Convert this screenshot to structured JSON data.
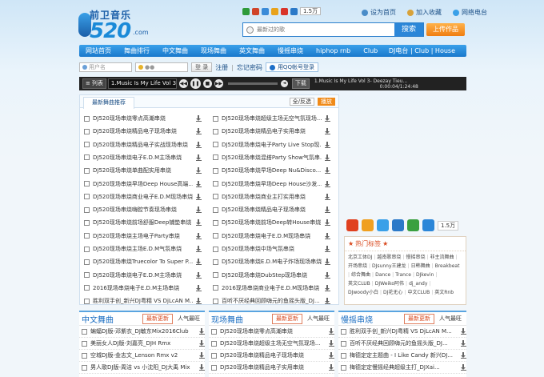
{
  "header": {
    "logo_cn": "前卫音乐",
    "logo_num": "520",
    "logo_com": ".com",
    "share_count": "1.5万",
    "links": [
      "设为首页",
      "加入收藏",
      "网络电台"
    ]
  },
  "search": {
    "placeholder": "最新过的歌",
    "button": "搜索"
  },
  "upload_label": "上传作品",
  "nav": {
    "items": [
      "网站首页",
      "舞曲排行",
      "中文舞曲",
      "现场舞曲",
      "英文舞曲",
      "慢摇串烧",
      "hiphop rnb",
      "Club"
    ],
    "right": "DJ电台 | Club | House"
  },
  "login": {
    "user_placeholder": "用户名",
    "pass_placeholder": "●●",
    "login_btn": "登 录",
    "register": "注册",
    "forgot": "忘记密码",
    "qq_btn": "用QQ帐号登录"
  },
  "player": {
    "list_label": "列表",
    "track_title": "1.Music Is My Life Vol 3- Dee",
    "download_label": "下载",
    "info_line1": "1.Music Is My Life Vol 3- Deezay Tieu...",
    "time": "0:00:04/1:24:48",
    "progress": 0.0
  },
  "main": {
    "tab": "最新舞曲推荐",
    "btn_all": "全/反选",
    "btn_play": "播放",
    "left_songs": [
      "DJ520现场串烧零点高潮串烧",
      "DJ520现场串烧精品电子现场串烧",
      "DJ520现场串烧精品电子实战现场串烧",
      "DJ520现场串烧电子E.D.M主场串烧",
      "DJ520现场串烧单曲配实用串烧",
      "DJ520现场串烧早场Deep House高端...",
      "DJ520现场串烧商业电子E.D.M现场串烧",
      "DJ520现场串烧嗨腔节奏现场串烧",
      "DJ520现场串烧前场舒服Deep铺垫串烧",
      "DJ520现场串烧主场电子Party串烧",
      "DJ520现场串烧主场E.D.M气氛串烧",
      "DJ520现场串烧Truecolor To Super P...",
      "DJ520现场串烧电子E.D.M主场串烧",
      "2016现场串烧电子E.D.M主场串烧",
      "胜利双手创_新兴DJ粤精 VS DjLcAN M..."
    ],
    "right_songs": [
      "DJ520现场串烧超级主场无空气氛现场...",
      "DJ520现场串烧精品电子实用串烧",
      "DJ520现场串烧电子Party Live Stop现...",
      "DJ520现场串烧混搭Party Show气氛串...",
      "DJ520现场串烧早场Deep Nu&Disco...",
      "DJ520现场串烧早场Deep House沙发...",
      "DJ520现场串烧商业主打实用串烧",
      "DJ520现场串烧精品电子现场串烧",
      "DJ520现场串烧前场Deep转House串烧",
      "DJ520现场串烧电子E.D.M现场串烧",
      "DJ520现场串烧中场气氛串烧",
      "DJ520现场串烧E.D.M电子炸场现场串烧",
      "DJ520现场串烧DubStep现场串烧",
      "2016现场串烧商业电子E.D.M现场串烧",
      "百听不厌经典回顾嗨元的鱼摇头版_DJ..."
    ]
  },
  "side": {
    "share_count": "1.5万",
    "hot_title": "热门标签",
    "tags": [
      "北京工体DJ",
      "越南歌串烧",
      "慢摇串烧",
      "非主流舞曲",
      "开场串烧",
      "DJsunny王建龙",
      "日韩舞曲",
      "Breakbeat",
      "综合舞曲",
      "Dance",
      "Trance",
      "DJkevin",
      "英文CLUB",
      "DJWeiko阿伟",
      "dj_andy",
      "DJwoody小白",
      "DJ花无心",
      "中文CLUB",
      "英文Rnb"
    ]
  },
  "bottom": [
    {
      "title": "中文舞曲",
      "tab1": "最新更新",
      "tab2": "人气最旺",
      "songs": [
        "蝙蝠DJ版-邓紫衣_DJ敏东Mix2016Club",
        "美丽女人DJ版-刘嘉亮_DJH Rmx",
        "空城DJ版-金志文_Lenson Rmx v2",
        "男人歌DJ版-周洁 vs 小沈阳_DJ大禹 Mix"
      ]
    },
    {
      "title": "现场舞曲",
      "tab1": "最新更新",
      "tab2": "人气最旺",
      "songs": [
        "DJ520现场串烧零点高潮串烧",
        "DJ520现场串烧超级主场无空气氛现场...",
        "DJ520现场串烧精品电子现场串烧",
        "DJ520现场串烧精品电子实用串烧"
      ]
    },
    {
      "title": "慢摇串烧",
      "tab1": "最新更新",
      "tab2": "人气最旺",
      "songs": [
        "胜利双手创_新兴DJ粤精 VS DjLcAN M...",
        "百听不厌经典回顾嗨元的鱼摇头版_DJ...",
        "梅德定定主题曲 - I Like Candy 新兴DJ...",
        "梅德定定慢摇经典超级主打_DJXai..."
      ]
    }
  ],
  "colors": {
    "nav": "#1a79cc",
    "accent_orange": "#f07d10",
    "tag_red": "#d94a1f"
  }
}
